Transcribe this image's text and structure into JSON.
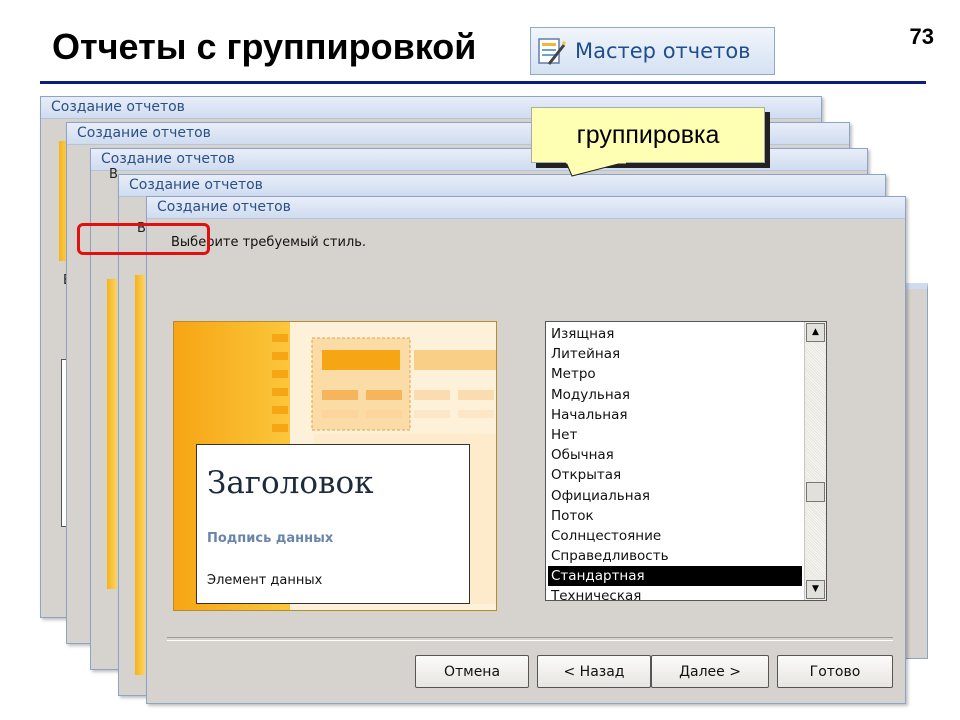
{
  "slide": {
    "title": "Отчеты с группировкой",
    "page_number": "73"
  },
  "toolbar_button": {
    "label": "Мастер отчетов",
    "icon": "report-wizard-icon"
  },
  "windows": {
    "title": "Создание отчетов",
    "prompt": "Выберите требуемый стиль.",
    "partial_text": {
      "w1_char": "В",
      "w2_char": "В",
      "w3_char": "В"
    }
  },
  "preview": {
    "heading": "Заголовок",
    "caption": "Подпись данных",
    "element": "Элемент данных"
  },
  "style_list": {
    "items": [
      "Изящная",
      "Литейная",
      "Метро",
      "Модульная",
      "Начальная",
      "Нет",
      "Обычная",
      "Открытая",
      "Официальная",
      "Поток",
      "Солнцестояние",
      "Справедливость",
      "Стандартная",
      "Техническая"
    ],
    "selected": "Стандартная"
  },
  "buttons": {
    "cancel": "Отмена",
    "back": "< Назад",
    "next": "Далее >",
    "done": "Готово"
  },
  "callout": {
    "text": "группировка"
  },
  "colors": {
    "accent_rule": "#0a1e7e",
    "highlight": "#e01010",
    "callout_bg": "#ffffb4",
    "preview_orange": "#f7b21b"
  }
}
